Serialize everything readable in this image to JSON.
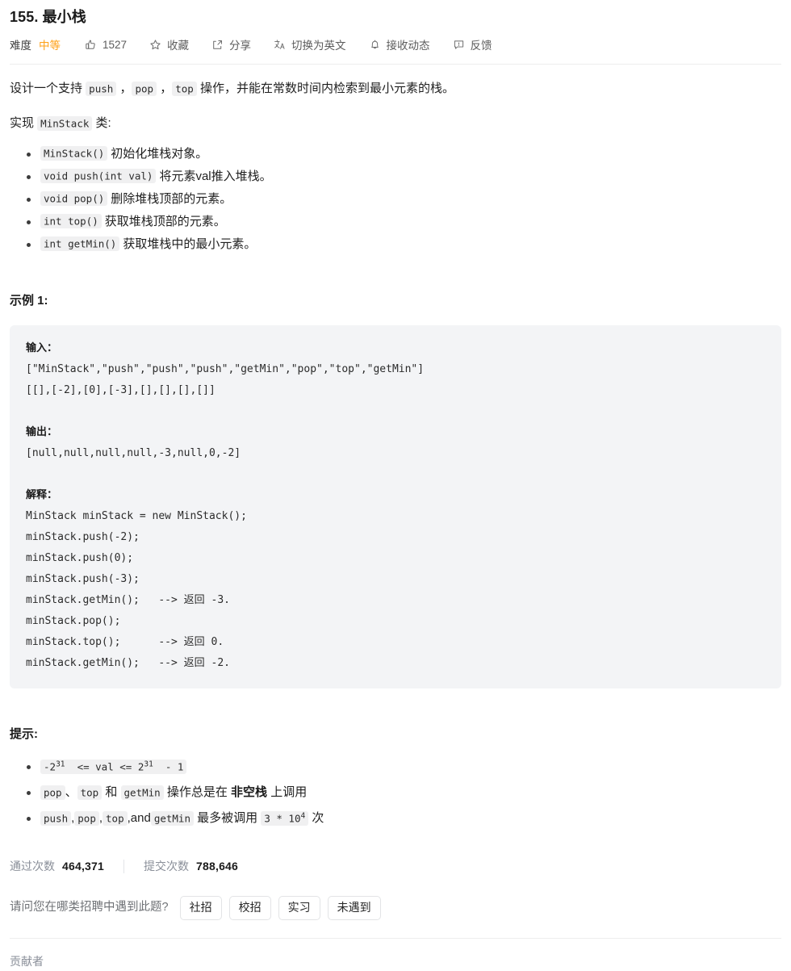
{
  "header": {
    "title": "155. 最小栈",
    "difficulty_label": "难度",
    "difficulty_value": "中等",
    "difficulty_color": "#ffa116",
    "likes": "1527",
    "favorite_label": "收藏",
    "share_label": "分享",
    "translate_label": "切换为英文",
    "subscribe_label": "接收动态",
    "feedback_label": "反馈",
    "icons": {
      "like": "thumbs-up-icon",
      "favorite": "star-icon",
      "share": "share-icon",
      "translate": "translate-icon",
      "subscribe": "bell-icon",
      "feedback": "feedback-icon"
    }
  },
  "description": {
    "p1_a": "设计一个支持 ",
    "p1_code1": "push",
    "p1_b": " ，",
    "p1_code2": "pop",
    "p1_c": " ，",
    "p1_code3": "top",
    "p1_d": " 操作，并能在常数时间内检索到最小元素的栈。",
    "p2_a": "实现 ",
    "p2_code": "MinStack",
    "p2_b": " 类:",
    "items": [
      {
        "code": "MinStack()",
        "text": "初始化堆栈对象。"
      },
      {
        "code": "void push(int val)",
        "text": "将元素val推入堆栈。"
      },
      {
        "code": "void pop()",
        "text": "删除堆栈顶部的元素。"
      },
      {
        "code": "int top()",
        "text": "获取堆栈顶部的元素。"
      },
      {
        "code": "int getMin()",
        "text": "获取堆栈中的最小元素。"
      }
    ]
  },
  "example": {
    "heading": "示例 1:",
    "input_label": "输入：",
    "input_lines": [
      "[\"MinStack\",\"push\",\"push\",\"push\",\"getMin\",\"pop\",\"top\",\"getMin\"]",
      "[[],[-2],[0],[-3],[],[],[],[]]"
    ],
    "output_label": "输出：",
    "output_lines": [
      "[null,null,null,null,-3,null,0,-2]"
    ],
    "explain_label": "解释：",
    "explain_lines": [
      "MinStack minStack = new MinStack();",
      "minStack.push(-2);",
      "minStack.push(0);",
      "minStack.push(-3);",
      "minStack.getMin();   --> 返回 -3.",
      "minStack.pop();",
      "minStack.top();      --> 返回 0.",
      "minStack.getMin();   --> 返回 -2."
    ]
  },
  "hints": {
    "heading": "提示:",
    "h1_code_pre": "-2",
    "h1_code_sup1": "31",
    "h1_code_mid": "  <= val <= 2",
    "h1_code_sup2": "31",
    "h1_code_post": "  - 1",
    "h2_code1": "pop",
    "h2_sep1": "、",
    "h2_code2": "top",
    "h2_sep2": " 和 ",
    "h2_code3": "getMin",
    "h2_text1": " 操作总是在 ",
    "h2_bold": "非空栈",
    "h2_text2": " 上调用",
    "h3_code1": "push",
    "h3_sep1": ",",
    "h3_code2": "pop",
    "h3_sep2": ",",
    "h3_code3": "top",
    "h3_sep3": ",and",
    "h3_code4": "getMin",
    "h3_text": " 最多被调用 ",
    "h3_num_pre": "3 * 10",
    "h3_num_sup": "4",
    "h3_text2": " 次"
  },
  "stats": {
    "accepted_label": "通过次数",
    "accepted_value": "464,371",
    "submissions_label": "提交次数",
    "submissions_value": "788,646"
  },
  "survey": {
    "question": "请问您在哪类招聘中遇到此题?",
    "options": [
      "社招",
      "校招",
      "实习",
      "未遇到"
    ]
  },
  "footer": {
    "contributor_label": "贡献者"
  }
}
